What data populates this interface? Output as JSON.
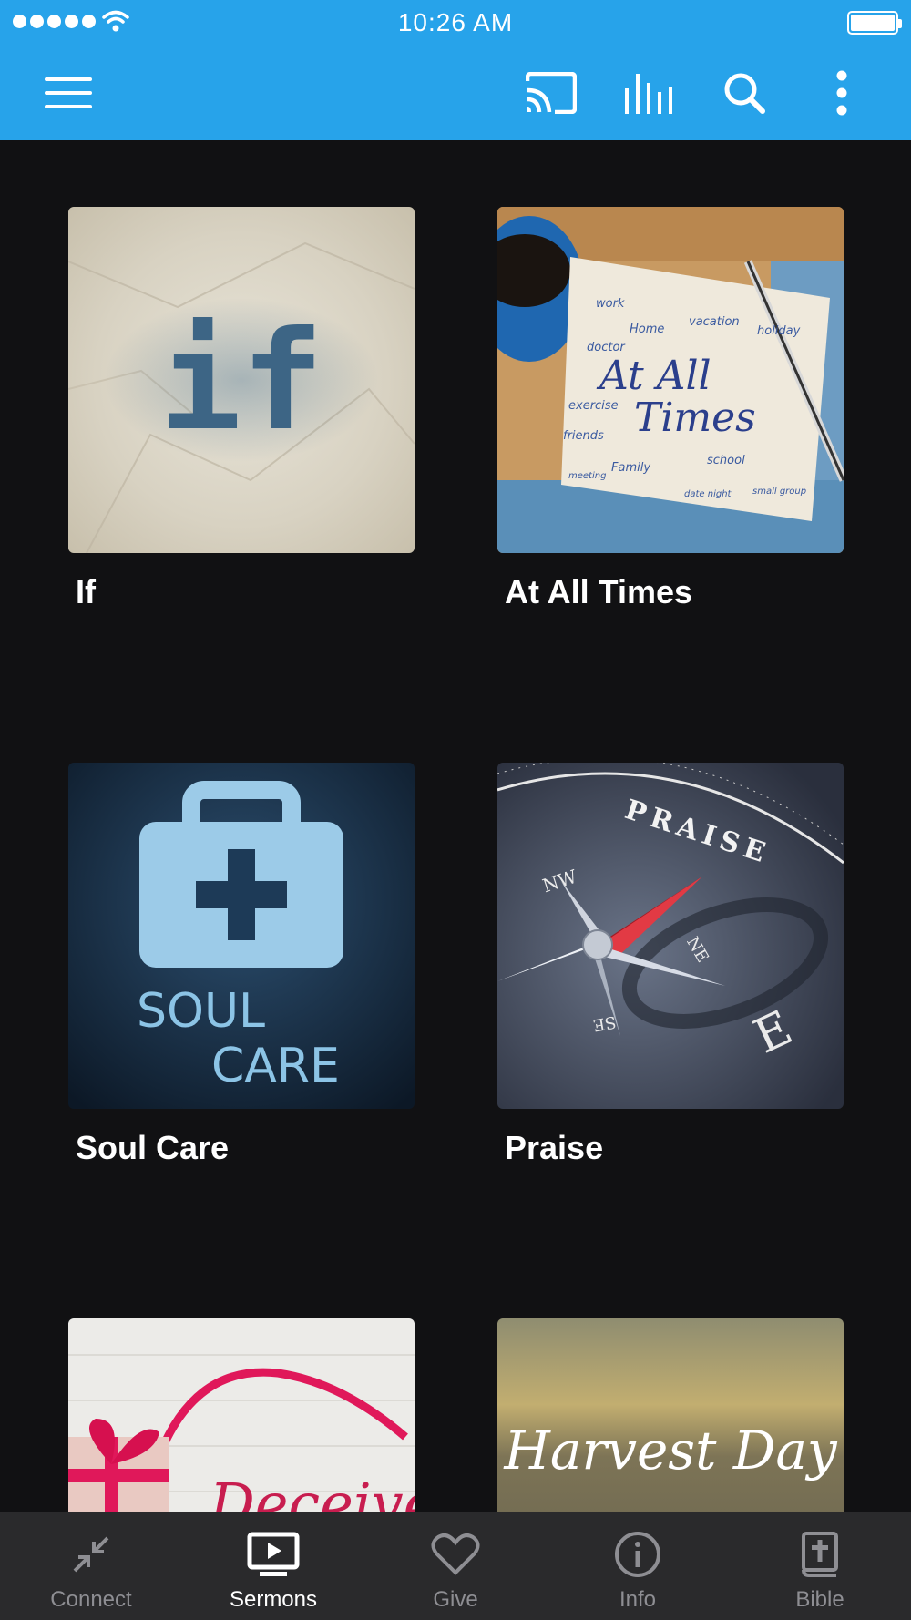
{
  "status_bar": {
    "time": "10:26 AM"
  },
  "app_bar": {
    "icons": [
      "menu-icon",
      "cast-icon",
      "equalizer-icon",
      "search-icon",
      "more-vertical-icon"
    ],
    "color": "#27a3ea"
  },
  "sermons": [
    {
      "title": "If",
      "art_text": "if"
    },
    {
      "title": "At All Times",
      "art_text": [
        "At All",
        "Times"
      ],
      "art_words": [
        "work",
        "Home",
        "vacation",
        "doctor",
        "holiday",
        "exercise",
        "friends",
        "Family",
        "school",
        "meeting",
        "date night",
        "small group"
      ]
    },
    {
      "title": "Soul Care",
      "art_text": [
        "SOUL",
        "CARE"
      ]
    },
    {
      "title": "Praise",
      "art_text": "PRAISE",
      "compass_labels": [
        "NW",
        "NE",
        "SE",
        "E"
      ]
    },
    {
      "title": "",
      "art_text": "Deceive"
    },
    {
      "title": "",
      "art_text": "Harvest Day"
    }
  ],
  "tab_bar": {
    "tabs": [
      {
        "label": "Connect",
        "icon": "connect-icon",
        "active": false
      },
      {
        "label": "Sermons",
        "icon": "sermons-play-icon",
        "active": true
      },
      {
        "label": "Give",
        "icon": "heart-icon",
        "active": false
      },
      {
        "label": "Info",
        "icon": "info-icon",
        "active": false
      },
      {
        "label": "Bible",
        "icon": "bible-icon",
        "active": false
      }
    ]
  }
}
